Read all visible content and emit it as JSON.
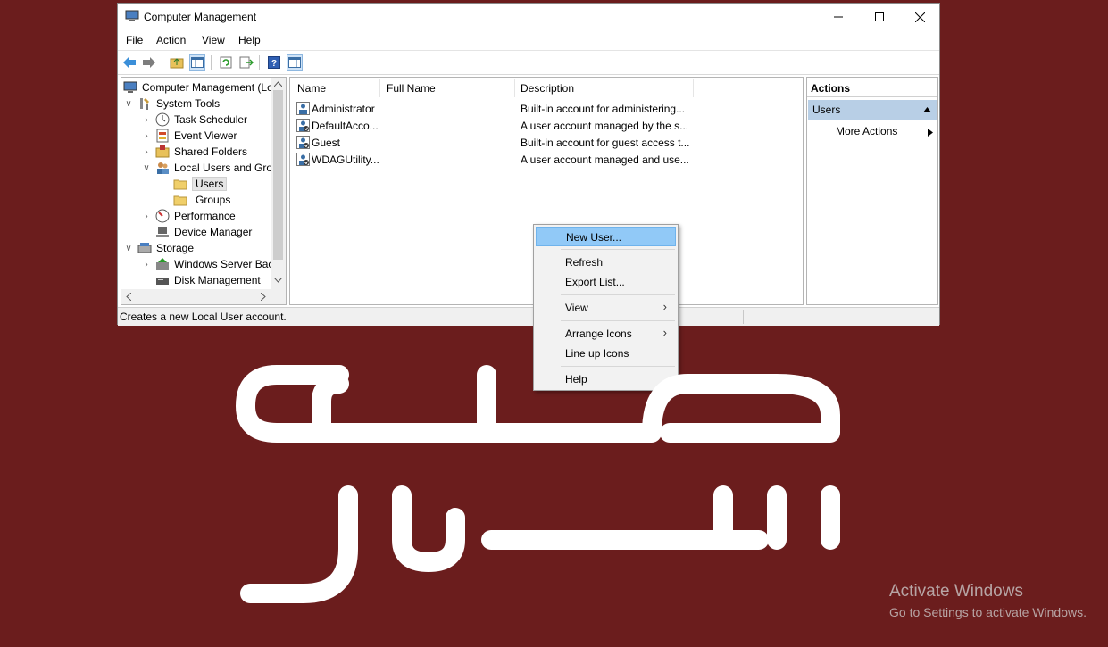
{
  "window": {
    "title": "Computer Management",
    "menu": [
      "File",
      "Action",
      "View",
      "Help"
    ]
  },
  "tree": {
    "root": "Computer Management (Lo",
    "system_tools": "System Tools",
    "task_scheduler": "Task Scheduler",
    "event_viewer": "Event Viewer",
    "shared_folders": "Shared Folders",
    "local_users": "Local Users and Grou",
    "users": "Users",
    "groups": "Groups",
    "performance": "Performance",
    "device_manager": "Device Manager",
    "storage": "Storage",
    "windows_server_backup": "Windows Server Bac",
    "disk_management": "Disk Management"
  },
  "list": {
    "columns": [
      "Name",
      "Full Name",
      "Description"
    ],
    "rows": [
      {
        "name": "Administrator",
        "full_name": "",
        "description": "Built-in account for administering..."
      },
      {
        "name": "DefaultAcco...",
        "full_name": "",
        "description": "A user account managed by the s..."
      },
      {
        "name": "Guest",
        "full_name": "",
        "description": "Built-in account for guest access t..."
      },
      {
        "name": "WDAGUtility...",
        "full_name": "",
        "description": "A user account managed and use..."
      }
    ]
  },
  "actions": {
    "header": "Actions",
    "section": "Users",
    "more": "More Actions"
  },
  "status": "Creates a new Local User account.",
  "context_menu": {
    "new_user": "New User...",
    "refresh": "Refresh",
    "export_list": "Export List...",
    "view": "View",
    "arrange_icons": "Arrange Icons",
    "line_up_icons": "Line up Icons",
    "help": "Help"
  },
  "watermark": {
    "line1": "Activate Windows",
    "line2": "Go to Settings to activate Windows."
  },
  "colors": {
    "background": "#6b1d1d",
    "highlight": "#91c9f7",
    "actions_section": "#b8cfe6"
  }
}
